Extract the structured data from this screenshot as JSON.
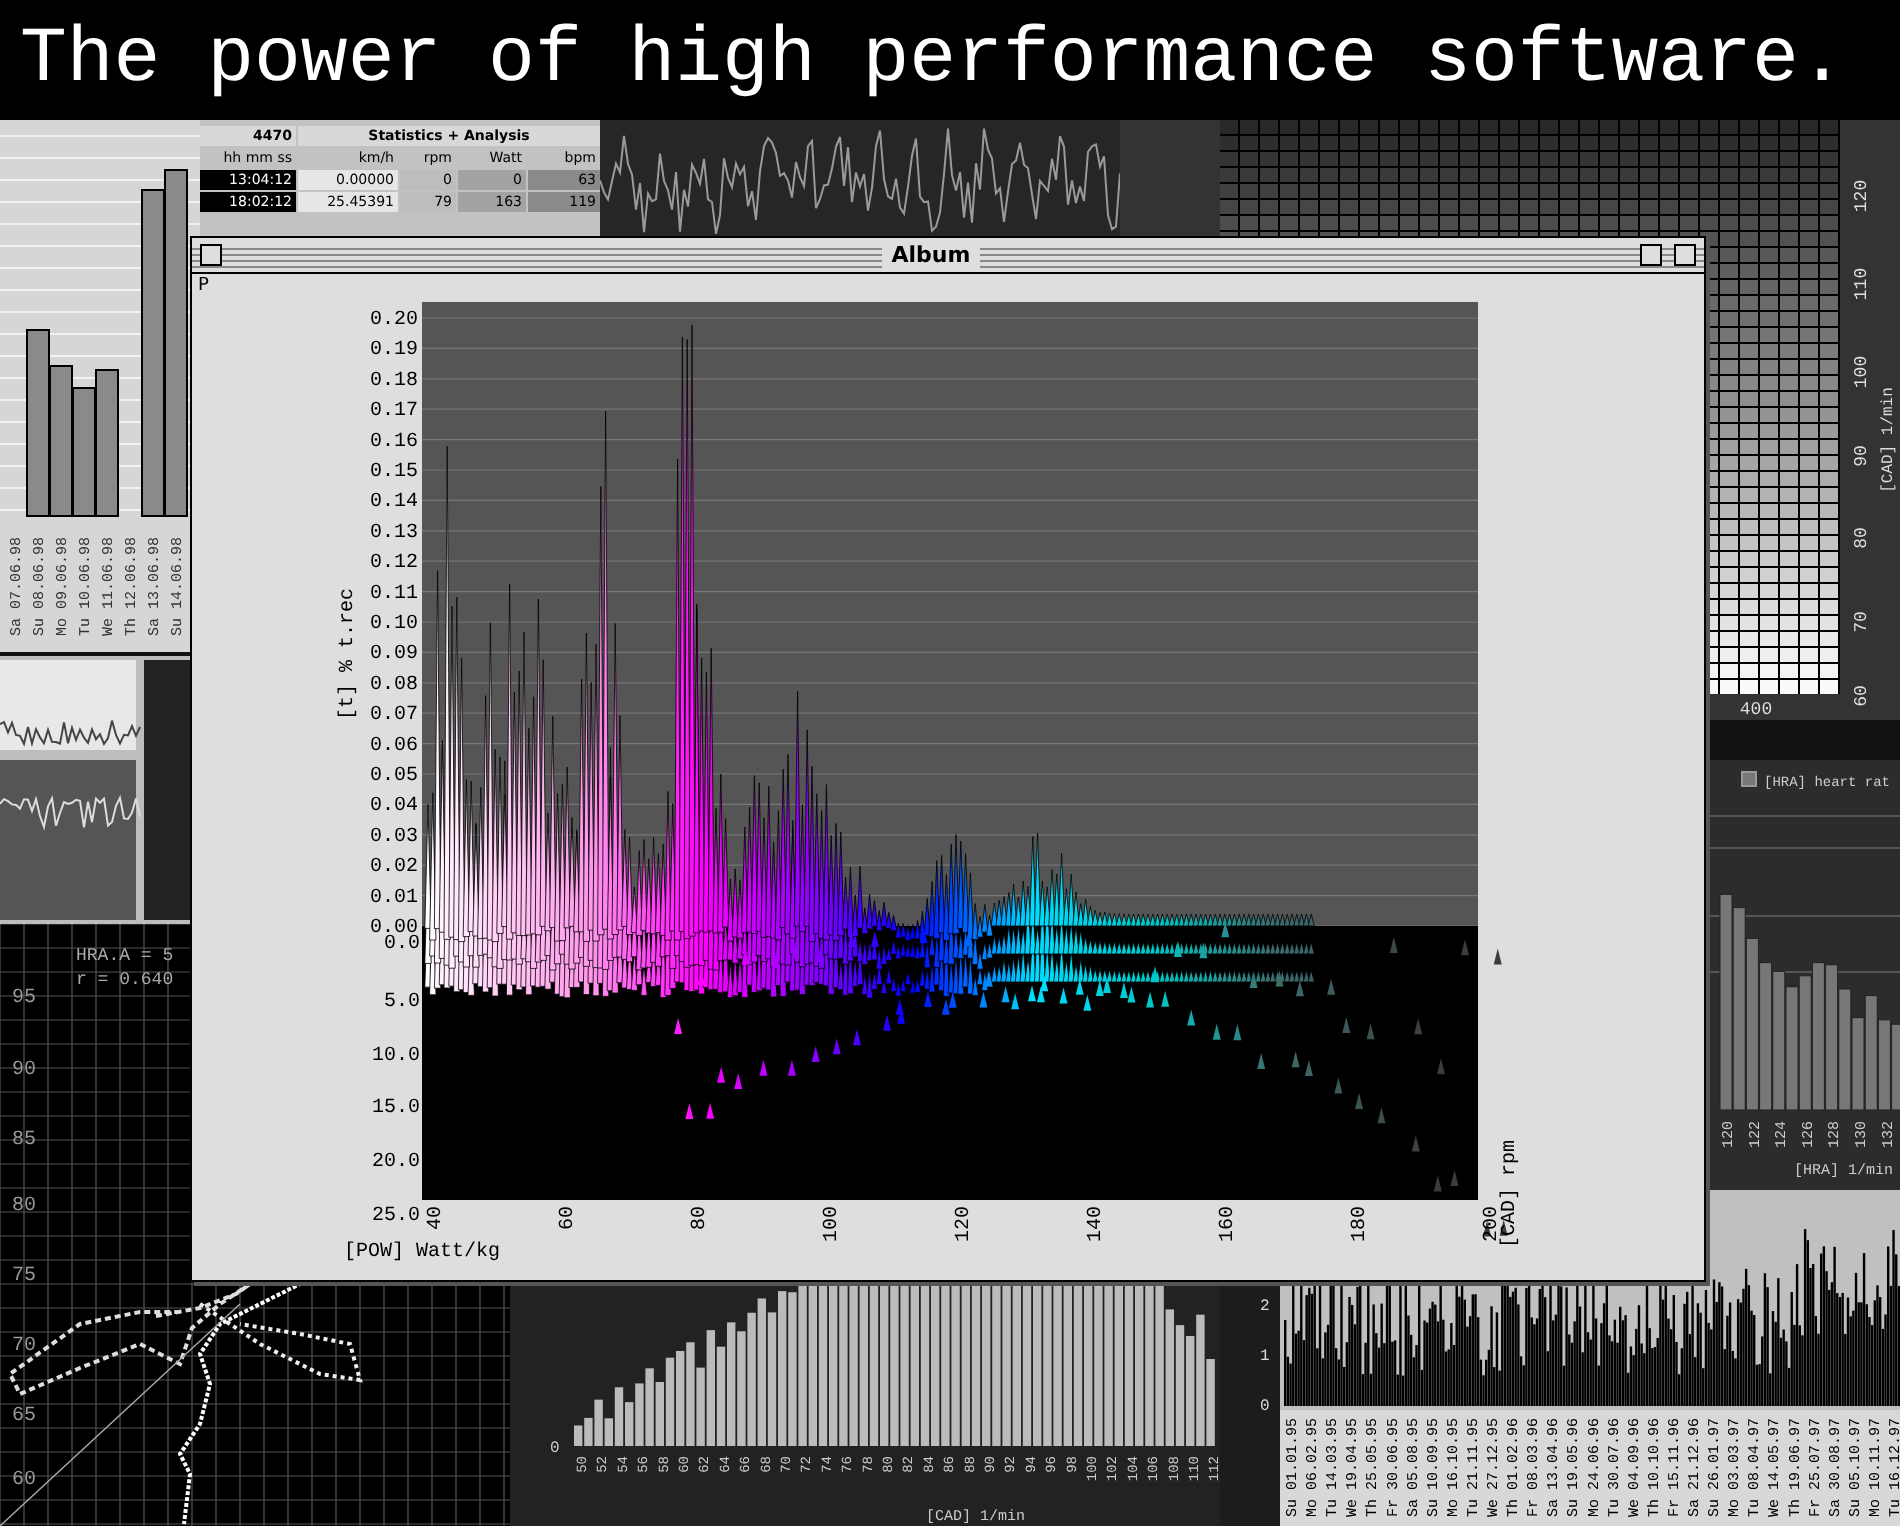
{
  "headline": "The power of high performance software.",
  "week_chart": {
    "dates": [
      "Sa 07.06.98",
      "Su 08.06.98",
      "Mo 09.06.98",
      "Tu 10.06.98",
      "We 11.06.98",
      "Th 12.06.98",
      "Sa 13.06.98",
      "Su 14.06.98"
    ]
  },
  "stats_table": {
    "id": "4470",
    "title": "Statistics + Analysis",
    "columns": [
      "hh mm ss",
      "km/h",
      "rpm",
      "Watt",
      "bpm"
    ],
    "rows": [
      [
        "13:04:12",
        "0.00000",
        "0",
        "0",
        "63"
      ],
      [
        "18:02:12",
        "25.45391",
        "79",
        "163",
        "119"
      ]
    ]
  },
  "cadence_grid": {
    "yticks": [
      "120",
      "110",
      "100",
      "90",
      "80",
      "70",
      "60"
    ],
    "xtick": "400",
    "ylabel": "[CAD] 1/min"
  },
  "scatter": {
    "equation": "HRA.A = 5",
    "r": "r = 0.640",
    "yticks": [
      "95",
      "90",
      "85",
      "80",
      "75",
      "70",
      "65",
      "60"
    ]
  },
  "heart_rate": {
    "legend": "[HRA] heart rat",
    "xticks": [
      "120",
      "122",
      "124",
      "126",
      "128",
      "130",
      "132"
    ],
    "xlabel": "[HRA] 1/min"
  },
  "cadence_histogram": {
    "ytick": "0",
    "xticks": [
      "50",
      "52",
      "54",
      "56",
      "58",
      "60",
      "62",
      "64",
      "66",
      "68",
      "70",
      "72",
      "74",
      "76",
      "78",
      "80",
      "82",
      "84",
      "86",
      "88",
      "90",
      "92",
      "94",
      "96",
      "98",
      "100",
      "102",
      "104",
      "106",
      "108",
      "110",
      "112"
    ],
    "xlabel": "[CAD] 1/min"
  },
  "timeline": {
    "yticks": [
      "2",
      "1",
      "0"
    ],
    "dates": [
      "Su 01.01.95",
      "Mo 06.02.95",
      "Tu 14.03.95",
      "We 19.04.95",
      "Th 25.05.95",
      "Fr 30.06.95",
      "Sa 05.08.95",
      "Su 10.09.95",
      "Mo 16.10.95",
      "Tu 21.11.95",
      "We 27.12.95",
      "Th 01.02.96",
      "Fr 08.03.96",
      "Sa 13.04.96",
      "Su 19.05.96",
      "Mo 24.06.96",
      "Tu 30.07.96",
      "We 04.09.96",
      "Th 10.10.96",
      "Fr 15.11.96",
      "Sa 21.12.96",
      "Su 26.01.97",
      "Mo 03.03.97",
      "Tu 08.04.97",
      "We 14.05.97",
      "Th 19.06.97",
      "Fr 25.07.97",
      "Sa 30.08.97",
      "Su 05.10.97",
      "Mo 10.11.97",
      "Tu 16.12.97"
    ]
  },
  "album": {
    "title": "Album",
    "corner_label": "P",
    "ylabel": "[t] % t.rec",
    "yticks": [
      "0.20",
      "0.19",
      "0.18",
      "0.17",
      "0.16",
      "0.15",
      "0.14",
      "0.13",
      "0.12",
      "0.11",
      "0.10",
      "0.09",
      "0.08",
      "0.07",
      "0.06",
      "0.05",
      "0.04",
      "0.03",
      "0.02",
      "0.01",
      "0.00"
    ],
    "depth_ticks": [
      "0.0",
      "5.0",
      "10.0",
      "15.0",
      "20.0",
      "25.0"
    ],
    "xticks": [
      "40",
      "60",
      "80",
      "100",
      "120",
      "140",
      "160",
      "180",
      "200"
    ],
    "xlabel": "[POW] Watt/kg",
    "depth_label": "[CAD] rpm"
  }
}
